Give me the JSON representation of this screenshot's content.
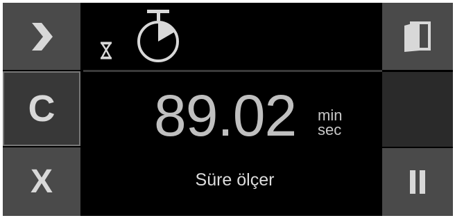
{
  "left_buttons": [
    {
      "icon": "chevron-right-icon"
    },
    {
      "icon": "c-letter-icon",
      "glyph": "C"
    },
    {
      "icon": "x-letter-icon",
      "glyph": "X"
    }
  ],
  "right_buttons": [
    {
      "icon": "door-exit-icon"
    },
    {
      "icon": ""
    },
    {
      "icon": "pause-icon"
    }
  ],
  "header": {
    "icons": [
      "hourglass-icon",
      "stopwatch-icon"
    ]
  },
  "display": {
    "value": "89.02",
    "unit_top": "min",
    "unit_bottom": "sec",
    "label": "Süre ölçer"
  },
  "colors": {
    "background": "#000000",
    "button": "#4a4a4a",
    "icon": "#d8d8d8",
    "value_text": "#c0c0c0"
  }
}
